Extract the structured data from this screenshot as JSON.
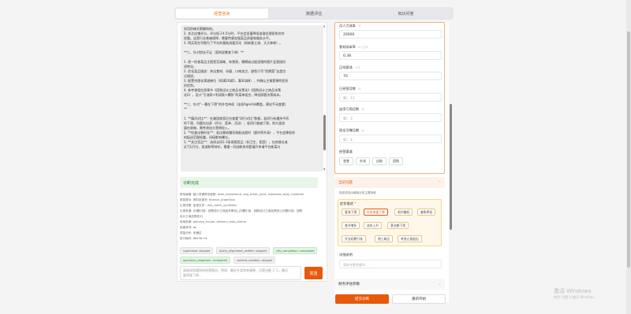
{
  "tabs": [
    {
      "label": "经营咨询"
    },
    {
      "label": "数据评估"
    },
    {
      "label": "知识问答"
    }
  ],
  "stream_lines": [
    "采用阶梯式薪酬结构。",
    "2. 关注店铺评分，评分低于4.5分时，平台会显著降低该锚位搜索排名的",
    "权重。这是行业普遍规律，需要特意加强菜品质量和服务水平。",
    "3. 明买家在早期为了平台的基础流量活动（如新客立减、天天神券）。",
    "",
    "**二、针对钥长不足（案例说需查下单）**",
    "",
    "1. 逐一检查菜品主图是否清晰、有食欲，模糊或过度滤镜的图片会直接伤",
    "进转化。",
    "2. 优化菜品描述：突出食材、份量、口味卖点，避免只写“招牌菜”这类空",
    "泛描述。",
    "3. 配置合理化满减梯位（如满20减5，满30减8），并确认主推套餐明显折",
    "扣优势。",
    "4. 参考课程信息章节《团购设计之商品本策化》《团购设计之商品本策",
    "化2》，设计“引流款+利润款+爆款”的菜单组合，降低顾客决策成本。",
    "",
    "**三、针对“一番在下滑”的外包持续（连续Agent未覆盖，建议手动查看）",
    "**",
    "",
    "1. **痛问对比**：在美团商家后台查看“同行对比”数据，若同行有遇持平而",
    "你下滑，问题在自身（评分、菜单、活动）；若同行普遍下滑，则大道流",
    "量在收缩，需考虑加大营销投入。",
    "2. **检查出餐时长**：若出餐较慢导致配送超时（超时率升高），平台会降低你",
    "的配送范围权重，间接影响曝光。",
    "3. **关注竞品**：选续去同1-3条周围竞品（如卫生、图西），在其餐位或",
    "近7天开分、差减和等待衬，需要一同战联系则套填开申请平台新菜与"
  ],
  "diag_title": "诊断完成",
  "meta_lines": [
    "财务画像: 缺少关键财务参数: total_investment, avg_ticket_price, expected_daily_customer",
    "风险提示: 资料未填写: finance_projection",
    "止损决策: 信息欠完：risk_check_synthesis",
    "引用来源: [问题引用：团购设计之商品本策化] [问题引用：团购设计之商品策划] [问题引用：团购",
    "设计之商品策划3]",
    "所用来源: delivery_funnel, delivery_kata_theme",
    "经营状况: ok",
    "质量分析: 未通过",
    "执行耗时: 88436 ms"
  ],
  "tags": [
    {
      "label": "supervisor: skipped",
      "status": "normal"
    },
    {
      "label": "query_alignment_verifier: skipped",
      "status": "normal"
    },
    {
      "label": "info_completion: completed",
      "status": "ok"
    },
    {
      "label": "operation_diagnosis: completed",
      "status": "ok"
    },
    {
      "label": "content_creation: skipped",
      "status": "normal"
    },
    {
      "label": "cost_optimization: skipped",
      "status": "normal"
    }
  ],
  "chat": {
    "placeholder_line1": "请描述您遇到的经营情况。例如：最近外卖利单量降，月营业额 3 万，最近",
    "placeholder_line2": "要改变了新...",
    "send_label": "发送"
  },
  "form": {
    "fields": [
      {
        "label": "月人力成本",
        "hint": "元",
        "value": "20000",
        "placeholder": false
      },
      {
        "label": "食材成本率",
        "hint": "0-1之间",
        "value": "0.38",
        "placeholder": false
      },
      {
        "label": "日均客流",
        "hint": "人次",
        "value": "70",
        "placeholder": false
      },
      {
        "label": "已经营月数",
        "hint": "月",
        "value": "如：12",
        "placeholder": true
      },
      {
        "label": "连续亏损月数",
        "hint": "月",
        "value": "如：3",
        "placeholder": true
      },
      {
        "label": "现金可撑月数",
        "hint": "月",
        "value": "如：4",
        "placeholder": true
      }
    ],
    "channels_label": "经营渠道",
    "channels": [
      "堂食",
      "外卖",
      "自取",
      "团购"
    ]
  },
  "issues": {
    "title": "当前问题",
    "desc": "描述或选出最接近的主要困难",
    "box_title": "症状描述",
    "chips": [
      {
        "label": "客流下滑",
        "selected": false
      },
      {
        "label": "外卖单量下降",
        "selected": true
      },
      {
        "label": "毛利偏低",
        "selected": false
      },
      {
        "label": "复购率低",
        "selected": false
      },
      {
        "label": "差评增多",
        "selected": false
      },
      {
        "label": "成本上升",
        "selected": false
      },
      {
        "label": "营业额下滑",
        "selected": false
      },
      {
        "label": "开业初期引流",
        "selected": false
      },
      {
        "label": "想上新品",
        "selected": false
      },
      {
        "label": "考虑止损退出",
        "selected": false
      }
    ],
    "detail_label": "详细说明",
    "detail_placeholder": "请补充更多细节..."
  },
  "finance_section": "财务评估参数",
  "actions": {
    "submit": "提交诊断",
    "reset": "重新开始"
  },
  "watermark": {
    "line1": "激活 Windows",
    "line2": "转到“设置”以激活 Windows。"
  }
}
